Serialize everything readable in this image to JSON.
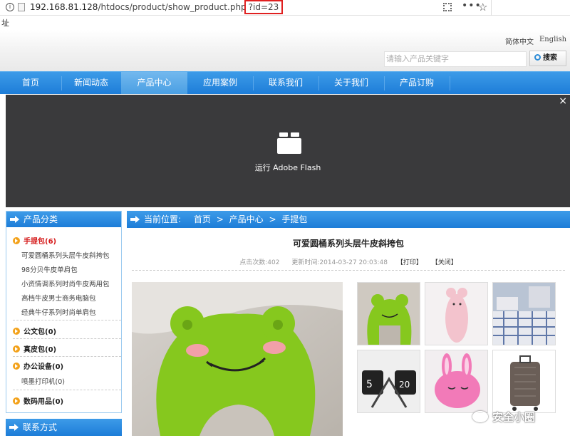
{
  "browser": {
    "url_host": "192.168.81.128",
    "url_path": "/htdocs/product/show_product.php",
    "url_query": "?id=23",
    "addr_fragment": "址"
  },
  "header": {
    "lang_cn": "简体中文",
    "lang_en": "English",
    "search_placeholder": "请输入产品关键字",
    "search_button": "搜索"
  },
  "nav": {
    "items": [
      "首页",
      "新闻动态",
      "产品中心",
      "应用案例",
      "联系我们",
      "关于我们",
      "产品订购"
    ],
    "active": "产品中心"
  },
  "flash": {
    "label": "运行 Adobe Flash",
    "close": "×"
  },
  "sidebar": {
    "title": "产品分类",
    "categories": [
      {
        "label": "手提包(6)",
        "subs": [
          "可爱圆桶系列头层牛皮斜挎包",
          "98分贝牛皮单肩包",
          "小资情调系列时尚牛皮两用包",
          "高档牛皮男士商务电脑包",
          "经典牛仔系列时尚单肩包"
        ]
      },
      {
        "label": "公文包(0)",
        "subs": []
      },
      {
        "label": "真皮包(0)",
        "subs": []
      },
      {
        "label": "办公设备(0)",
        "subs": [
          "喷墨打印机(0)"
        ]
      },
      {
        "label": "数码用品(0)",
        "subs": []
      }
    ],
    "contact_title": "联系方式"
  },
  "breadcrumb": {
    "prefix": "当前位置:",
    "items": [
      "首页",
      "产品中心",
      "手提包"
    ],
    "sep": ">"
  },
  "product": {
    "title": "可爱圆桶系列头层牛皮斜挎包",
    "clicks": "点击次数:402",
    "updated": "更新时间:2014-03-27 20:03:48",
    "print": "【打印】",
    "close": "【关闭】"
  },
  "watermark": "安全小圈",
  "colors": {
    "nav_blue": "#1d7dd8",
    "highlight_red": "#e02020",
    "category_red": "#d51b1b",
    "bullet_orange": "#f3a21b",
    "flash_bg": "#3a3a3c"
  }
}
